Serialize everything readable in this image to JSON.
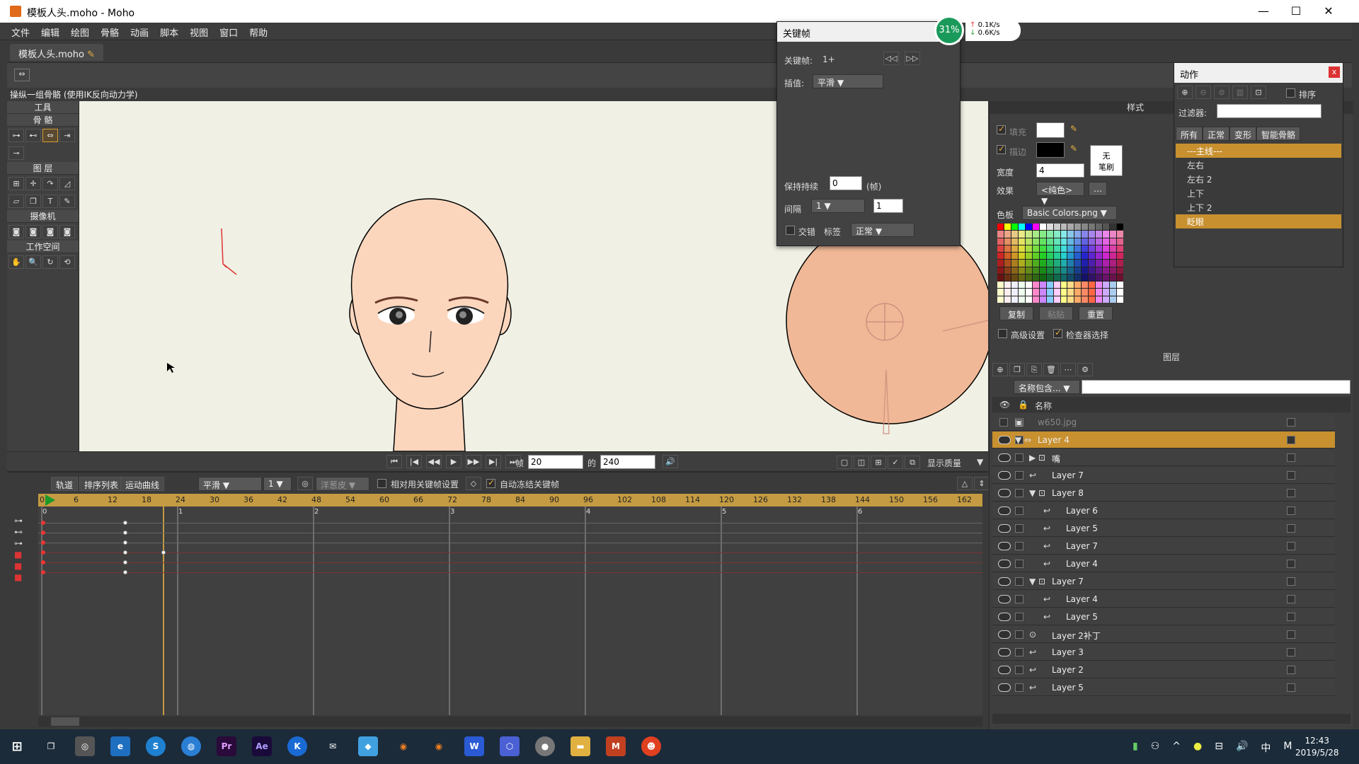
{
  "window": {
    "title": "模板人头.moho - Moho",
    "minimize": "—",
    "maximize": "☐",
    "close": "✕"
  },
  "menu": [
    "文件",
    "编辑",
    "绘图",
    "骨骼",
    "动画",
    "脚本",
    "视图",
    "窗口",
    "帮助"
  ],
  "doc_tab": "模板人头.moho",
  "status_hint": "操纵一组骨骼 (使用IK反向动力学)",
  "tools": {
    "header": "工具",
    "bone": "骨 骼",
    "layer": "图 层",
    "camera": "摄像机",
    "workspace": "工作空间"
  },
  "playback": {
    "frame_label": "帧",
    "frame_value": "20",
    "of_label": "的",
    "total_frames": "240",
    "display_quality": "显示质量"
  },
  "timeline": {
    "tabs": [
      "轨道",
      "排序列表",
      "运动曲线"
    ],
    "interp": "平滑",
    "interp_num": "1",
    "onion": "洋葱皮",
    "relative_keys": "相对用关键帧设置",
    "auto_freeze": "自动冻结关键帧",
    "ruler": [
      "0",
      "6",
      "12",
      "18",
      "24",
      "30",
      "36",
      "42",
      "48",
      "54",
      "60",
      "66",
      "72",
      "78",
      "84",
      "90",
      "96",
      "102",
      "108",
      "114",
      "120",
      "126",
      "132",
      "138",
      "144",
      "150",
      "156",
      "162"
    ],
    "sections": [
      "0",
      "1",
      "2",
      "3",
      "4",
      "5",
      "6"
    ]
  },
  "keyframe_dialog": {
    "title": "关键帧",
    "keyframe_label": "关键帧:",
    "keyframe_value": "1+",
    "interp_label": "插值:",
    "interp_value": "平滑",
    "hold_label": "保持持续",
    "hold_value": "0",
    "hold_unit": "(帧)",
    "interval_label": "间隔",
    "interval_dd": "1",
    "interval_value": "1",
    "alternate": "交错",
    "tag_label": "标签",
    "tag_value": "正常"
  },
  "net_monitor": {
    "percent": "31%",
    "up": "0.1K/s",
    "down": "0.6K/s"
  },
  "style_panel": {
    "header": "样式",
    "fill": "填充",
    "stroke": "描边",
    "no_brush": "无\n笔刷",
    "width_label": "宽度",
    "width_value": "4",
    "effect_label": "效果",
    "effect_value": "<纯色>",
    "palette_label": "色板",
    "palette_value": "Basic Colors.png",
    "copy": "复制",
    "paste": "粘贴",
    "reset": "重置",
    "advanced": "高级设置",
    "check_select": "检查器选择"
  },
  "actions_panel": {
    "title": "动作",
    "sort": "排序",
    "filter_label": "过滤器:",
    "tabs": [
      "所有",
      "正常",
      "变形",
      "智能骨骼"
    ],
    "items": [
      "---主线---",
      "左右",
      "左右 2",
      "上下",
      "上下 2",
      "眨眼"
    ]
  },
  "layers_panel": {
    "header": "图层",
    "filter": "名称包含...",
    "name_col": "名称",
    "rows": [
      {
        "name": "w650.jpg"
      },
      {
        "name": "Layer 4"
      },
      {
        "name": "嘴"
      },
      {
        "name": "Layer 7"
      },
      {
        "name": "Layer 8"
      },
      {
        "name": "Layer 6"
      },
      {
        "name": "Layer 5"
      },
      {
        "name": "Layer 7"
      },
      {
        "name": "Layer 4"
      },
      {
        "name": "Layer 7"
      },
      {
        "name": "Layer 4"
      },
      {
        "name": "Layer 5"
      },
      {
        "name": "Layer 2补丁"
      },
      {
        "name": "Layer 3"
      },
      {
        "name": "Layer 2"
      },
      {
        "name": "Layer 5"
      }
    ]
  },
  "taskbar": {
    "time": "12:43",
    "date": "2019/5/28",
    "ime": "中",
    "ime2": "M",
    "apps": [
      "Pr",
      "Ae",
      "K"
    ]
  },
  "colors": {
    "accent": "#c8902f",
    "canvas_bg": "#f0f0e4",
    "skin": "#fbd6bd"
  }
}
